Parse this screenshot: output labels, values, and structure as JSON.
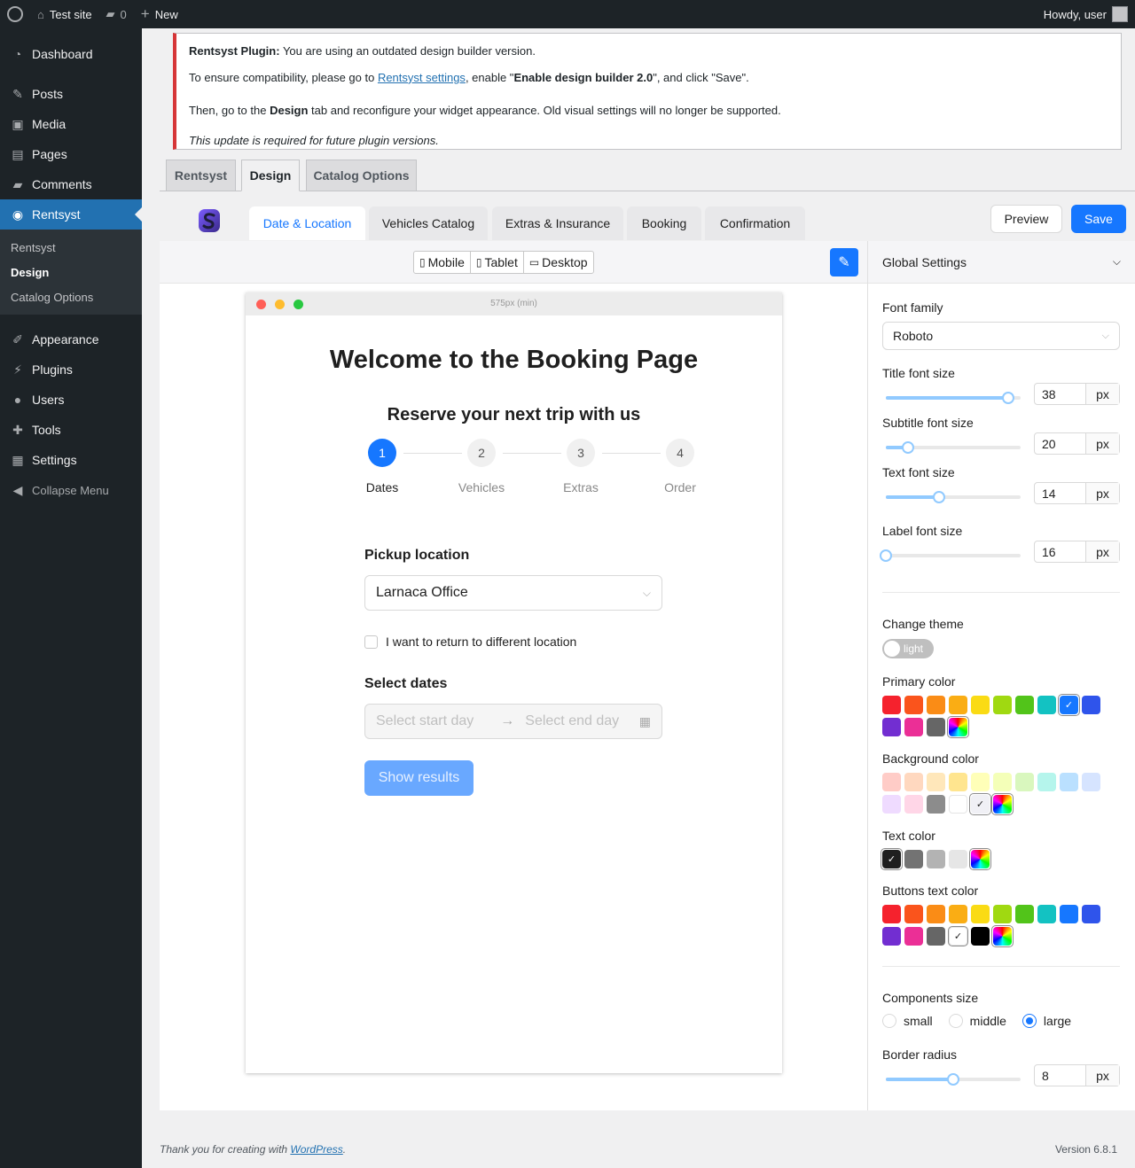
{
  "adminbar": {
    "site": "Test site",
    "comments": "0",
    "new": "New",
    "howdy": "Howdy, user"
  },
  "menu": {
    "dashboard": "Dashboard",
    "posts": "Posts",
    "media": "Media",
    "pages": "Pages",
    "comments": "Comments",
    "rentsyst": "Rentsyst",
    "sub": [
      "Rentsyst",
      "Design",
      "Catalog Options"
    ],
    "appearance": "Appearance",
    "plugins": "Plugins",
    "users": "Users",
    "tools": "Tools",
    "settings": "Settings",
    "collapse": "Collapse Menu"
  },
  "notice": {
    "p1_strong": "Rentsyst Plugin:",
    "p1": " You are using an outdated design builder version.",
    "p2_a": "To ensure compatibility, please go to ",
    "p2_link": "Rentsyst settings",
    "p2_b": ", enable \"",
    "p2_strong": "Enable design builder 2.0",
    "p2_c": "\", and click \"Save\".",
    "p3_a": "Then, go to the ",
    "p3_strong": "Design",
    "p3_b": " tab and reconfigure your widget appearance. Old visual settings will no longer be supported.",
    "p4": "This update is required for future plugin versions."
  },
  "navtabs": [
    "Rentsyst",
    "Design",
    "Catalog Options"
  ],
  "steptabs": [
    "Date & Location",
    "Vehicles Catalog",
    "Extras & Insurance",
    "Booking",
    "Confirmation"
  ],
  "actions": {
    "preview": "Preview",
    "save": "Save"
  },
  "devices": [
    "Mobile",
    "Tablet",
    "Desktop"
  ],
  "frame": {
    "size": "575px (min)",
    "title": "Welcome to the Booking Page",
    "subtitle": "Reserve your next trip with us",
    "steps": [
      {
        "n": "1",
        "label": "Dates"
      },
      {
        "n": "2",
        "label": "Vehicles"
      },
      {
        "n": "3",
        "label": "Extras"
      },
      {
        "n": "4",
        "label": "Order"
      }
    ],
    "pickup_label": "Pickup location",
    "pickup_value": "Larnaca Office",
    "return_check": "I want to return to different location",
    "dates_label": "Select dates",
    "start_ph": "Select start day",
    "end_ph": "Select end day",
    "show_btn": "Show results"
  },
  "panel": {
    "head": "Global Settings",
    "font_family_label": "Font family",
    "font_family": "Roboto",
    "title_size_label": "Title font size",
    "title_size": "38",
    "subtitle_size_label": "Subtitle font size",
    "subtitle_size": "20",
    "text_size_label": "Text font size",
    "text_size": "14",
    "label_size_label": "Label font size",
    "label_size": "16",
    "unit": "px",
    "theme_label": "Change theme",
    "theme": "light",
    "primary_label": "Primary color",
    "bg_label": "Background color",
    "text_color_label": "Text color",
    "btn_text_label": "Buttons text color",
    "size_label": "Components size",
    "sizes": [
      "small",
      "middle",
      "large"
    ],
    "radius_label": "Border radius",
    "radius": "8"
  },
  "footer": {
    "thanks": "Thank you for creating with ",
    "wp": "WordPress",
    "dot": ".",
    "version": "Version 6.8.1"
  }
}
